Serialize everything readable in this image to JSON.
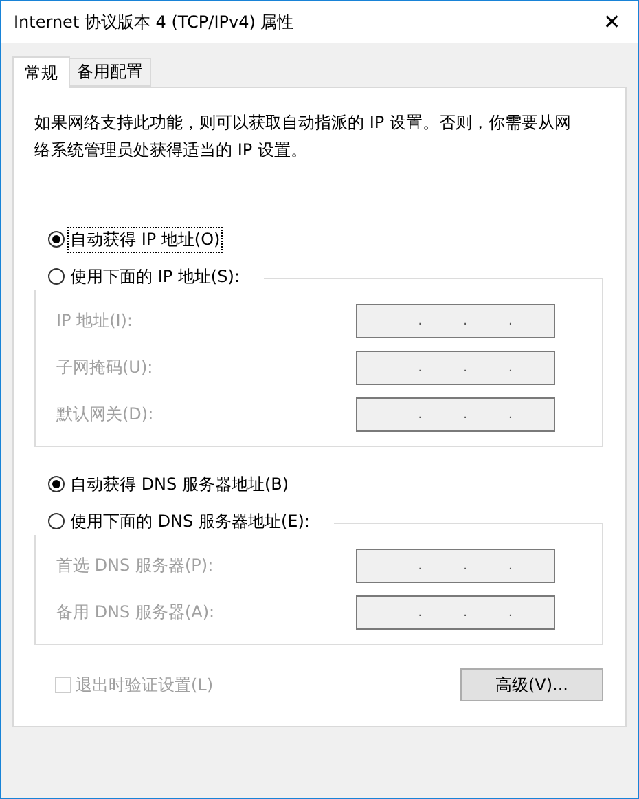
{
  "window": {
    "title": "Internet 协议版本 4 (TCP/IPv4) 属性",
    "close": "✕"
  },
  "tabs": [
    {
      "label": "常规",
      "selected": true
    },
    {
      "label": "备用配置",
      "selected": false
    }
  ],
  "description": "如果网络支持此功能，则可以获取自动指派的 IP 设置。否则，你需要从网络系统管理员处获得适当的 IP 设置。",
  "sections": [
    {
      "auto": {
        "label": "自动获得 IP 地址(O)",
        "selected": true,
        "focused": true
      },
      "manual": {
        "label": "使用下面的 IP 地址(S):",
        "selected": false
      },
      "fields": [
        {
          "label": "IP 地址(I):",
          "disabled": true,
          "dots": [
            ".",
            ".",
            "."
          ]
        },
        {
          "label": "子网掩码(U):",
          "disabled": true,
          "dots": [
            ".",
            ".",
            "."
          ]
        },
        {
          "label": "默认网关(D):",
          "disabled": true,
          "dots": [
            ".",
            ".",
            "."
          ]
        }
      ]
    },
    {
      "auto": {
        "label": "自动获得 DNS 服务器地址(B)",
        "selected": true,
        "focused": false
      },
      "manual": {
        "label": "使用下面的 DNS 服务器地址(E):",
        "selected": false
      },
      "fields": [
        {
          "label": "首选 DNS 服务器(P):",
          "disabled": true,
          "dots": [
            ".",
            ".",
            "."
          ]
        },
        {
          "label": "备用 DNS 服务器(A):",
          "disabled": true,
          "dots": [
            ".",
            ".",
            "."
          ]
        }
      ]
    }
  ],
  "validate": {
    "label": "退出时验证设置(L)",
    "checked": false,
    "disabled": true
  },
  "advanced_button": "高级(V)..."
}
